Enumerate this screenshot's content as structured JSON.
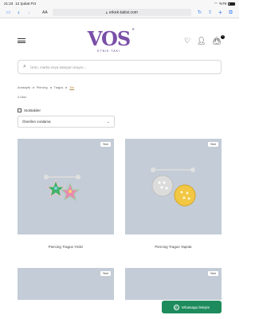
{
  "status": {
    "time": "21:23",
    "date": "12 Şubat Pzt",
    "battery": "%79"
  },
  "browser": {
    "aa_label": "AA",
    "url": "erkek-takisi.com",
    "icons": [
      "sidebar-icon",
      "back-icon",
      "forward-icon",
      "lock-icon",
      "reload-icon",
      "share-icon",
      "new-tab-icon",
      "tabs-icon"
    ]
  },
  "header": {
    "logo_text": "VOS",
    "logo_registered": "®",
    "logo_subtitle": "ETNİK TAKI",
    "cart_count": "0",
    "brand_color": "#4a2a7a"
  },
  "search": {
    "placeholder": "Ürün, marka veya kategori arayın..."
  },
  "breadcrumb": {
    "items": [
      "Anasayfa",
      "Piercing",
      "Tragus",
      "Tek"
    ]
  },
  "result_count": "4 Ürün",
  "filter": {
    "label": "Stoktakiler"
  },
  "sort": {
    "selected": "Önerilen sıralama"
  },
  "products": [
    {
      "name": "Piercing Tragus Yıldız",
      "badge": "Yeni"
    },
    {
      "name": "Piercing Tragus Yaprak",
      "badge": "Yeni"
    },
    {
      "name": "",
      "badge": "Yeni"
    },
    {
      "name": "",
      "badge": "Yeni"
    }
  ],
  "whatsapp": {
    "label": "Whatsapp İletişim",
    "color": "#1d8b5c"
  }
}
